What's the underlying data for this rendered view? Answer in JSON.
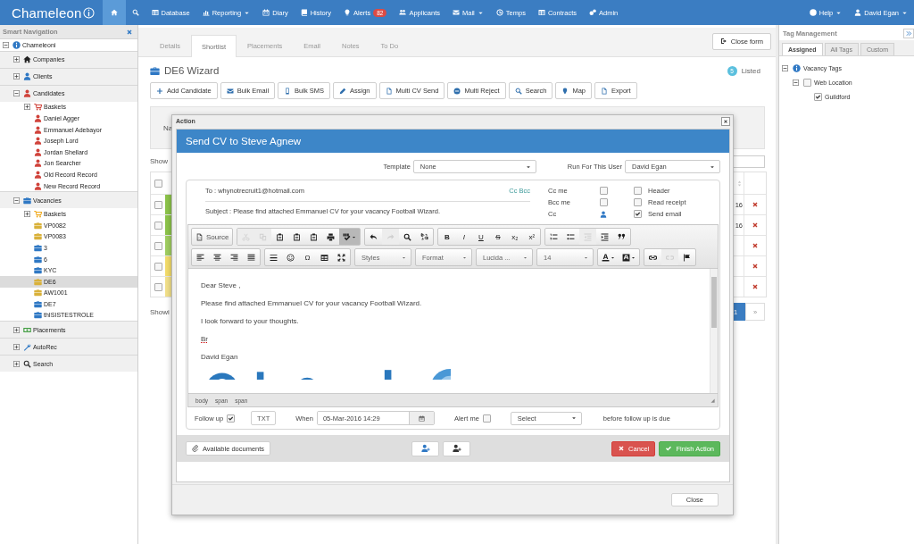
{
  "nav": {
    "logo": "Chameleon",
    "items": [
      {
        "kind": "icon",
        "selected": true
      },
      {
        "kind": "icon",
        "selected": false
      },
      {
        "kind": "link",
        "label": "Database",
        "dropdown": false,
        "selected": false
      },
      {
        "kind": "link",
        "label": "Reporting",
        "dropdown": true,
        "selected": false
      },
      {
        "kind": "link",
        "label": "Diary",
        "dropdown": false,
        "selected": false
      },
      {
        "kind": "link",
        "label": "History",
        "dropdown": false,
        "selected": false
      },
      {
        "kind": "link",
        "label": "Alerts",
        "dropdown": false,
        "selected": false,
        "badge": "82"
      },
      {
        "kind": "link",
        "label": "Applicants",
        "dropdown": false,
        "selected": false
      },
      {
        "kind": "link",
        "label": "Mail",
        "dropdown": true,
        "selected": false
      },
      {
        "kind": "link",
        "label": "Temps",
        "dropdown": false,
        "selected": false
      },
      {
        "kind": "link",
        "label": "Contracts",
        "dropdown": false,
        "selected": false
      },
      {
        "kind": "link",
        "label": "Admin",
        "dropdown": false,
        "selected": false
      }
    ],
    "user_items": [
      {
        "label": "Help",
        "dropdown": true
      },
      {
        "label": "David Egan",
        "dropdown": true
      }
    ]
  },
  "sidebar": {
    "title": "Smart Navigation",
    "tree": [
      {
        "label": "Chameleoni",
        "kind": "info",
        "expanded": true,
        "selected": false,
        "children": [
          {
            "label": "Companies",
            "kind": "house",
            "expanded": false,
            "selected": false
          },
          {
            "label": "Clients",
            "kind": "person",
            "color": "#2f78c4",
            "expanded": false,
            "selected": false
          },
          {
            "label": "Candidates",
            "kind": "person",
            "color": "#d0433b",
            "expanded": true,
            "selected": false,
            "children": [
              {
                "label": "Baskets",
                "kind": "basket",
                "color": "#d0433b",
                "expanded": false,
                "selected": false
              },
              {
                "label": "Daniel Agger",
                "kind": "person",
                "color": "#d0433b",
                "selected": false
              },
              {
                "label": "Emmanuel Adebayor",
                "kind": "person",
                "color": "#d0433b",
                "selected": false
              },
              {
                "label": "Joseph Lord",
                "kind": "person",
                "color": "#d0433b",
                "selected": false
              },
              {
                "label": "Jordan Shellard",
                "kind": "person",
                "color": "#d0433b",
                "selected": false
              },
              {
                "label": "Jon Searcher",
                "kind": "person",
                "color": "#d0433b",
                "selected": false
              },
              {
                "label": "Old Record Record",
                "kind": "person",
                "color": "#d0433b",
                "selected": false
              },
              {
                "label": "New Record Record",
                "kind": "person",
                "color": "#d0433b",
                "selected": false
              }
            ]
          },
          {
            "label": "Vacancies",
            "kind": "vacancy",
            "color": "#2f78c4",
            "expanded": true,
            "selected": false,
            "children": [
              {
                "label": "Baskets",
                "kind": "basket",
                "color": "#f0a818",
                "expanded": false,
                "selected": false
              },
              {
                "label": "VP0082",
                "kind": "vacancy",
                "color": "#d9b13a",
                "selected": false
              },
              {
                "label": "VP0083",
                "kind": "vacancy",
                "color": "#d9b13a",
                "selected": false
              },
              {
                "label": "3",
                "kind": "vacancy",
                "color": "#2f78c4",
                "selected": false
              },
              {
                "label": "6",
                "kind": "vacancy",
                "color": "#2f78c4",
                "selected": false
              },
              {
                "label": "KYC",
                "kind": "vacancy",
                "color": "#2f78c4",
                "selected": false
              },
              {
                "label": "DE6",
                "kind": "vacancy",
                "color": "#d9b13a",
                "selected": true
              },
              {
                "label": "AW1001",
                "kind": "vacancy",
                "color": "#d9b13a",
                "selected": false
              },
              {
                "label": "DE7",
                "kind": "vacancy",
                "color": "#2f78c4",
                "selected": false
              },
              {
                "label": "thISISTESTROLE",
                "kind": "vacancy",
                "color": "#2f78c4",
                "selected": false
              }
            ]
          },
          {
            "label": "Placements",
            "kind": "money",
            "color": "#3a9a3a",
            "expanded": false,
            "selected": false
          },
          {
            "label": "AutoRec",
            "kind": "tool",
            "expanded": false,
            "selected": false
          },
          {
            "label": "Search",
            "kind": "search",
            "expanded": false,
            "selected": false
          }
        ]
      }
    ]
  },
  "content": {
    "tabs": [
      {
        "label": "Details",
        "selected": false
      },
      {
        "label": "Shortlist",
        "selected": true
      },
      {
        "label": "Placements",
        "selected": false
      },
      {
        "label": "Email",
        "selected": false
      },
      {
        "label": "Notes",
        "selected": false
      },
      {
        "label": "To Do",
        "selected": false
      }
    ],
    "close_form": "Close form",
    "title": "DE6 Wizard",
    "listed": {
      "count": "5",
      "label": "Listed"
    },
    "actions": [
      "Add Candidate",
      "Bulk Email",
      "Bulk SMS",
      "Assign",
      "Multi CV Send",
      "Multi Reject",
      "Search",
      "Map",
      "Export"
    ],
    "filter_label": "Na",
    "show_label": "Show",
    "table": {
      "header_checked": false,
      "rows": [
        {
          "checked": false,
          "color": "#8cc34a",
          "column_5": "16"
        },
        {
          "checked": false,
          "color": "#8cc34a",
          "column_5": "16"
        },
        {
          "checked": false,
          "color": "#9fcd60"
        },
        {
          "checked": false,
          "color": "#f3dc6b"
        },
        {
          "checked": false,
          "color": "#f2e08a"
        }
      ]
    },
    "footer_label": "Showi",
    "pagination": [
      {
        "label": "1",
        "selected": true
      },
      {
        "label": "»",
        "selected": false
      }
    ]
  },
  "dialog": {
    "title": "Action",
    "heading": "Send CV to Steve Agnew",
    "template": {
      "label": "Template",
      "value": "None"
    },
    "run_for": {
      "label": "Run For This User",
      "value": "David Egan"
    },
    "to": "To : whynotrecruit1@hotmail.com",
    "cc_bcc": "Cc Bcc",
    "subject": "Subject : Please find attached Emmanuel CV for your vacancy Football Wizard.",
    "options": [
      {
        "label": "Cc me",
        "kind": "checkbox",
        "checked": false
      },
      {
        "label": "Bcc me",
        "kind": "checkbox",
        "checked": false
      },
      {
        "label": "Cc",
        "kind": "person"
      }
    ],
    "flags": [
      {
        "label": "Header",
        "checked": false
      },
      {
        "label": "Read receipt",
        "checked": false
      },
      {
        "label": "Send email",
        "checked": true
      }
    ],
    "editor": {
      "toolbar": [
        [
          [
            {
              "kind": "labeled",
              "text": "Source"
            }
          ],
          [
            {
              "kind": "icon",
              "disabled": true,
              "on": false,
              "dropdown": false
            },
            {
              "kind": "icon",
              "disabled": true,
              "on": false,
              "dropdown": false
            },
            {
              "kind": "icon",
              "disabled": false,
              "on": false,
              "dropdown": false
            },
            {
              "kind": "icon",
              "disabled": false,
              "on": false,
              "dropdown": false
            },
            {
              "kind": "icon",
              "disabled": false,
              "on": false,
              "dropdown": false
            },
            {
              "kind": "icon",
              "disabled": false,
              "on": false,
              "dropdown": false
            },
            {
              "kind": "icon",
              "disabled": false,
              "on": true,
              "dropdown": true
            }
          ],
          [
            {
              "kind": "icon",
              "disabled": false,
              "on": false,
              "dropdown": false
            },
            {
              "kind": "icon",
              "disabled": true,
              "on": false,
              "dropdown": false
            },
            {
              "kind": "icon",
              "disabled": false,
              "on": false,
              "dropdown": false
            },
            {
              "kind": "icon",
              "disabled": false,
              "on": false,
              "dropdown": false
            }
          ],
          [
            {
              "kind": "bold",
              "text": "B"
            },
            {
              "kind": "italic",
              "text": "I"
            },
            {
              "kind": "underline",
              "text": "U"
            },
            {
              "kind": "strike",
              "text": "S"
            },
            {
              "kind": "glyph",
              "text": "x₂"
            },
            {
              "kind": "glyph",
              "text": "x²"
            }
          ],
          [
            {
              "kind": "icon",
              "disabled": false,
              "on": false,
              "dropdown": false
            },
            {
              "kind": "icon",
              "disabled": false,
              "on": false,
              "dropdown": false
            },
            {
              "kind": "icon",
              "disabled": true,
              "on": false,
              "dropdown": false
            },
            {
              "kind": "icon",
              "disabled": false,
              "on": false,
              "dropdown": false
            },
            {
              "kind": "icon",
              "disabled": false,
              "on": false,
              "dropdown": false
            }
          ]
        ],
        [
          [
            {
              "kind": "icon",
              "disabled": false,
              "on": false,
              "dropdown": false
            },
            {
              "kind": "icon",
              "disabled": false,
              "on": false,
              "dropdown": false
            },
            {
              "kind": "icon",
              "disabled": false,
              "on": false,
              "dropdown": false
            },
            {
              "kind": "icon",
              "disabled": false,
              "on": false,
              "dropdown": false
            }
          ],
          [
            {
              "kind": "icon",
              "disabled": false,
              "on": false,
              "dropdown": false
            },
            {
              "kind": "icon",
              "disabled": false,
              "on": false,
              "dropdown": false
            },
            {
              "kind": "glyph",
              "text": "Ω"
            },
            {
              "kind": "icon",
              "disabled": false,
              "on": false,
              "dropdown": false
            },
            {
              "kind": "icon",
              "disabled": false,
              "on": false,
              "dropdown": false
            }
          ],
          [
            {
              "kind": "combo",
              "text": "Styles"
            }
          ],
          [
            {
              "kind": "combo",
              "text": "Format"
            }
          ],
          [
            {
              "kind": "combo",
              "text": "Lucida ..."
            }
          ],
          [
            {
              "kind": "combo",
              "text": "14"
            }
          ],
          [
            {
              "kind": "icon",
              "disabled": false,
              "on": false,
              "dropdown": true
            },
            {
              "kind": "icon",
              "disabled": false,
              "on": false,
              "dropdown": true
            }
          ],
          [
            {
              "kind": "icon",
              "disabled": false,
              "on": false,
              "dropdown": false
            },
            {
              "kind": "icon",
              "disabled": true,
              "on": false,
              "dropdown": false
            },
            {
              "kind": "icon",
              "disabled": false,
              "on": false,
              "dropdown": false
            }
          ]
        ]
      ],
      "body": [
        {
          "text": "Dear Steve ,",
          "misspelled": false
        },
        {
          "text": "Please find attached Emmanuel CV for your vacancy Football Wizard.",
          "misspelled": false
        },
        {
          "text": "I look forward to your thoughts.",
          "misspelled": false
        },
        {
          "text": "Br",
          "misspelled": true
        },
        {
          "text": "David Egan",
          "misspelled": false
        }
      ],
      "signature": {
        "kind": "picture"
      },
      "path": [
        "body",
        "span",
        "span"
      ]
    },
    "follow_up": {
      "label": "Follow up",
      "checked": true,
      "txt": "TXT",
      "when_label": "When",
      "when": "05-Mar-2016 14:29",
      "alert_label": "Alert me",
      "alert_checked": false,
      "select": "Select",
      "suffix": "before follow up is due"
    },
    "documents": "Available documents",
    "cancel": "Cancel",
    "finish": "Finish Action",
    "close": "Close"
  },
  "tags": {
    "title": "Tag Management",
    "tabs": [
      {
        "label": "Assigned",
        "selected": true
      },
      {
        "label": "All Tags",
        "selected": false
      },
      {
        "label": "Custom",
        "selected": false
      }
    ],
    "tree": [
      {
        "label": "Vacancy Tags",
        "kind": "info",
        "expanded": true,
        "children": [
          {
            "label": "Web Location",
            "kind": "checkbox",
            "checked": false,
            "expanded": true,
            "children": [
              {
                "label": "Guildford",
                "kind": "checkbox",
                "checked": true
              }
            ]
          }
        ]
      }
    ]
  }
}
